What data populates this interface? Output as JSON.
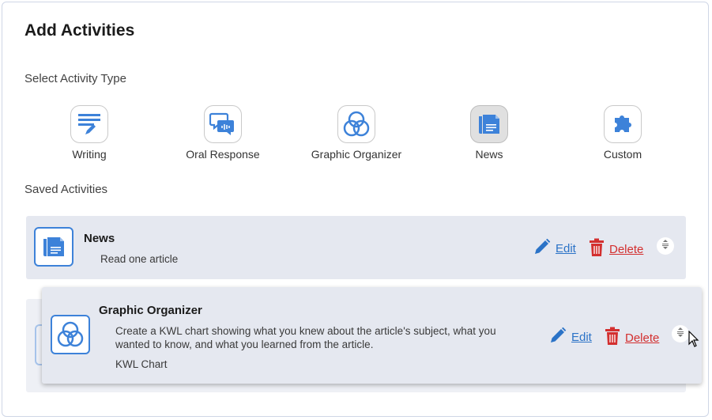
{
  "header": {
    "title": "Add Activities"
  },
  "activity_types": {
    "label": "Select Activity Type",
    "items": [
      {
        "label": "Writing",
        "icon": "writing-icon"
      },
      {
        "label": "Oral Response",
        "icon": "oral-response-icon"
      },
      {
        "label": "Graphic Organizer",
        "icon": "graphic-organizer-icon"
      },
      {
        "label": "News",
        "icon": "news-icon",
        "selected": true
      },
      {
        "label": "Custom",
        "icon": "puzzle-icon"
      }
    ]
  },
  "saved": {
    "label": "Saved Activities",
    "items": [
      {
        "title": "News",
        "description": "Read one article",
        "icon": "news-icon",
        "edit_label": "Edit",
        "delete_label": "Delete"
      },
      {
        "title": "Graphic Organizer",
        "description": "Create a KWL chart showing what you knew about the article's subject, what you wanted to know, and what you learned from the article.",
        "subtitle": "KWL Chart",
        "icon": "graphic-organizer-icon",
        "edit_label": "Edit",
        "delete_label": "Delete",
        "dragging": true
      }
    ]
  },
  "colors": {
    "accent": "#3d82d9",
    "link": "#2b73c7",
    "danger": "#d32f2f",
    "card_bg": "#e5e8f0"
  }
}
